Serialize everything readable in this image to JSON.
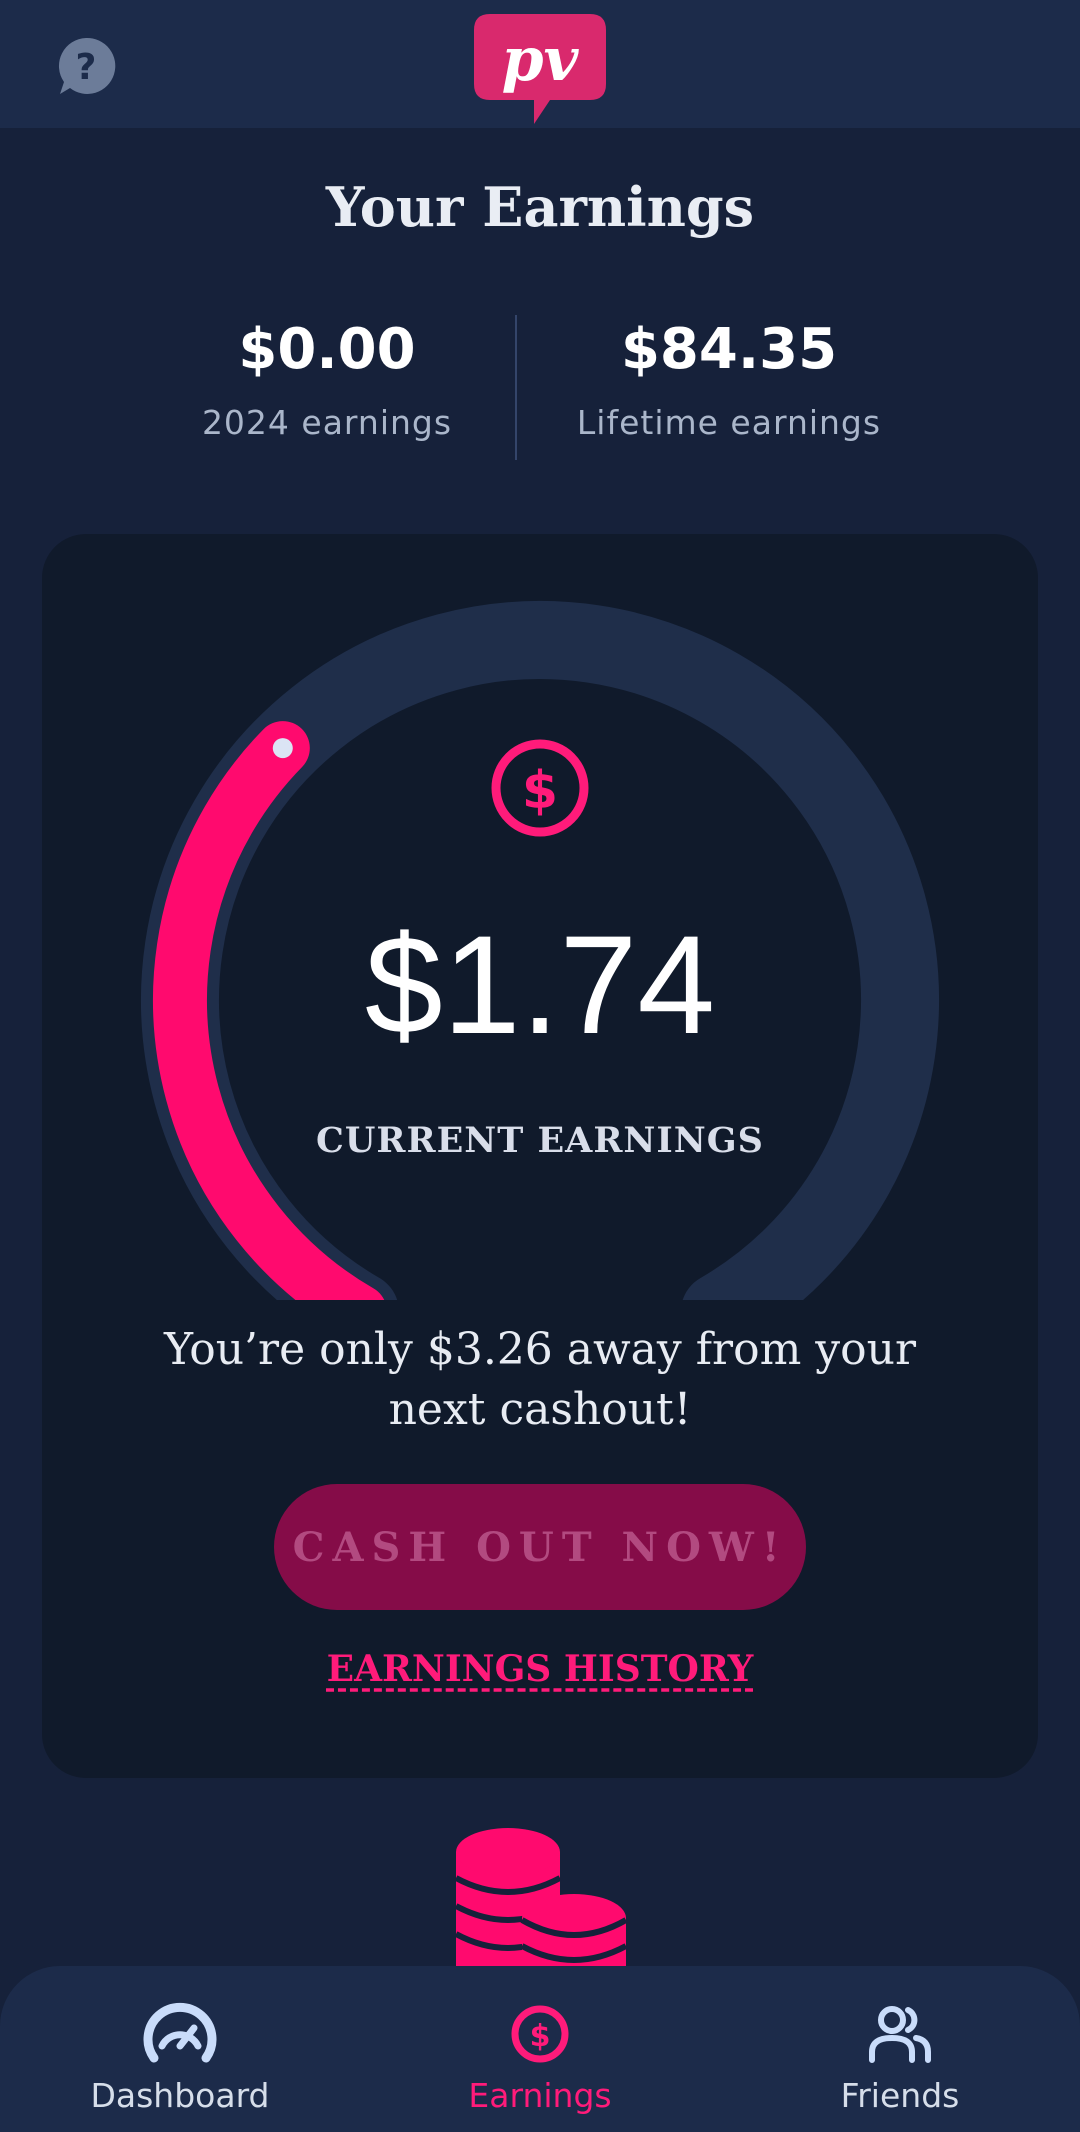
{
  "app": {
    "logo_text": "pv",
    "colors": {
      "accent": "#ff1b7a",
      "background": "#16213a",
      "card": "#101a2b",
      "gauge_track": "#1f2e4a"
    }
  },
  "header": {
    "help_icon": "help-icon",
    "logo_icon": "pv-logo"
  },
  "page": {
    "title": "Your Earnings"
  },
  "stats": {
    "year": {
      "value": "$0.00",
      "label": "2024 earnings"
    },
    "lifetime": {
      "value": "$84.35",
      "label": "Lifetime earnings"
    }
  },
  "gauge": {
    "icon": "dollar-circle-icon",
    "progress": 0.348,
    "current_value": "$1.74",
    "current_label": "CURRENT EARNINGS"
  },
  "message": "You’re only $3.26 away from your next cashout!",
  "cashout_button": {
    "label": "CASH OUT NOW!",
    "enabled": false
  },
  "history_link": "EARNINGS HISTORY",
  "decoration": {
    "icon": "coins-icon"
  },
  "nav": [
    {
      "label": "Dashboard",
      "icon": "dashboard-icon",
      "active": false
    },
    {
      "label": "Earnings",
      "icon": "dollar-circle-icon",
      "active": true
    },
    {
      "label": "Friends",
      "icon": "friends-icon",
      "active": false
    }
  ]
}
